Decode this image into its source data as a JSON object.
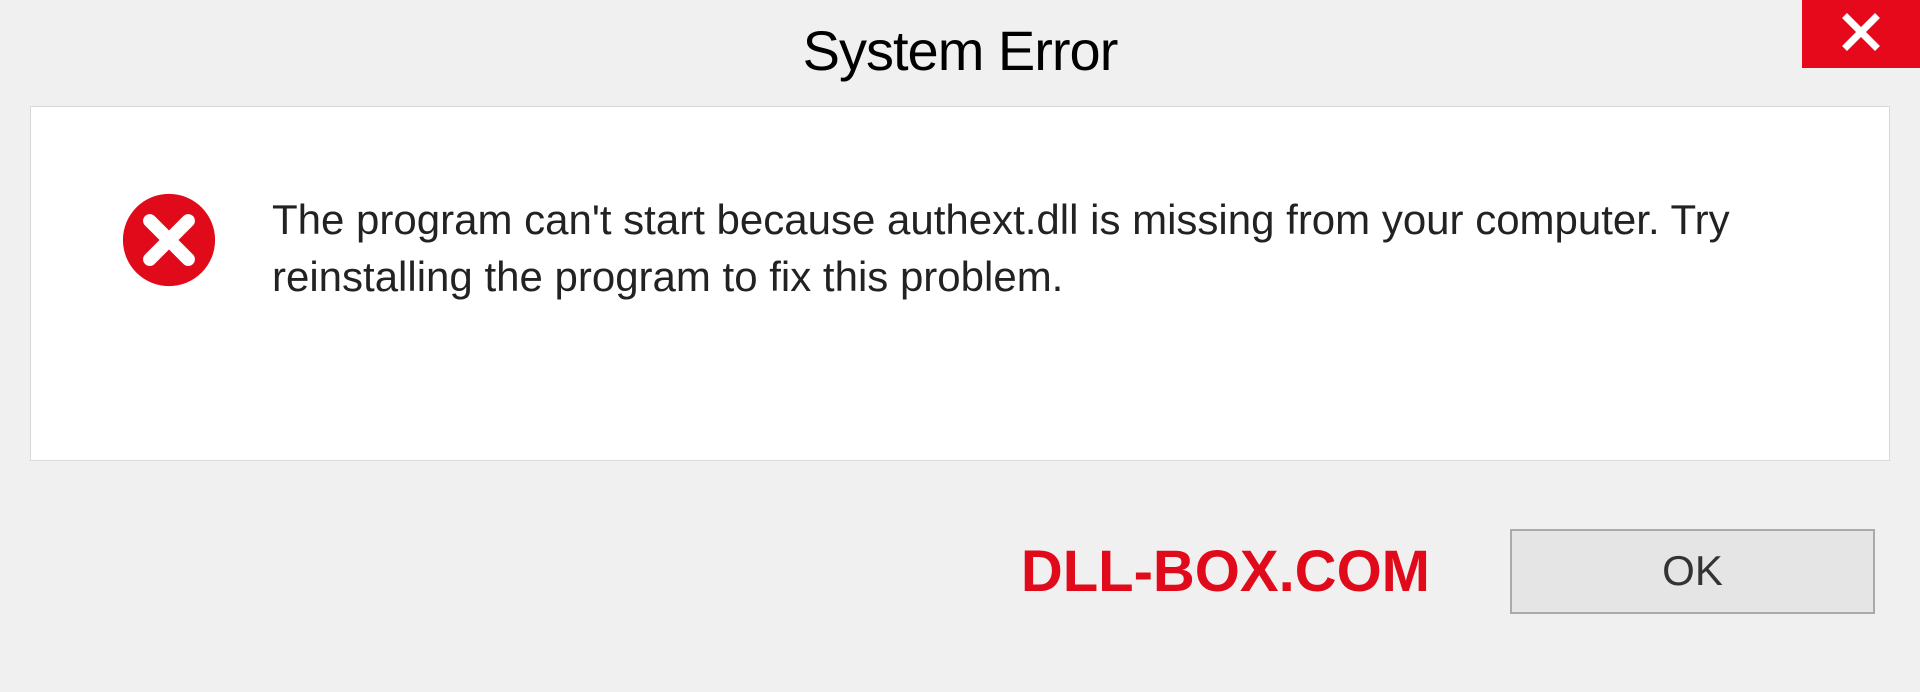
{
  "dialog": {
    "title": "System Error",
    "message": "The program can't start because authext.dll is missing from your computer. Try reinstalling the program to fix this problem.",
    "ok_label": "OK",
    "watermark": "DLL-BOX.COM"
  },
  "colors": {
    "close_bg": "#e5091b",
    "error_icon": "#e00a1b",
    "watermark": "#e00a1b"
  }
}
